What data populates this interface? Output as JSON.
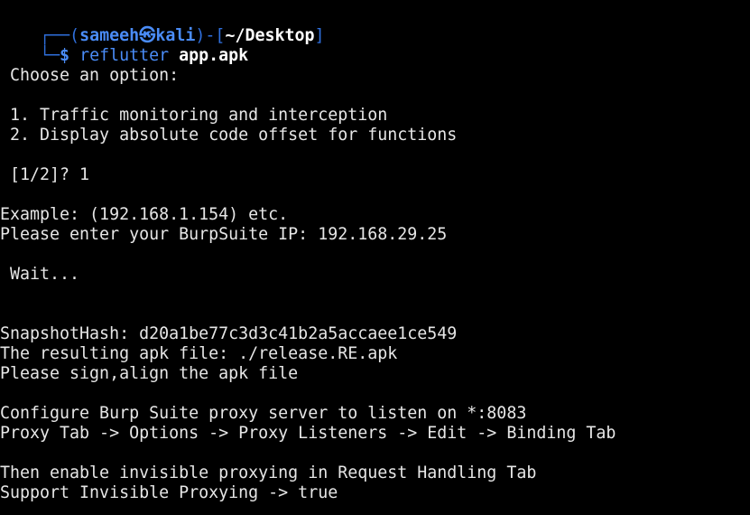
{
  "prompt": {
    "box_top": "┌──(",
    "user": "sameeh",
    "skull": "㉿",
    "host": "kali",
    "mid": ")-[",
    "cwd": "~/Desktop",
    "end": "]",
    "box_bottom": "└─",
    "dollar": "$ ",
    "command": "reflutter",
    "argument": "app.apk"
  },
  "output": {
    "choose": " Choose an option:",
    "option1": " 1. Traffic monitoring and interception",
    "option2": " 2. Display absolute code offset for functions",
    "answer": " [1/2]? 1",
    "example": "Example: (192.168.1.154) etc.",
    "enter_ip": "Please enter your BurpSuite IP: 192.168.29.25",
    "wait": " Wait...",
    "snapshot": "SnapshotHash: d20a1be77c3d3c41b2a5accaee1ce549",
    "result": "The resulting apk file: ./release.RE.apk",
    "sign": "Please sign,align the apk file",
    "configure": "Configure Burp Suite proxy server to listen on *:8083",
    "proxy_tab": "Proxy Tab -> Options -> Proxy Listeners -> Edit -> Binding Tab",
    "enable": "Then enable invisible proxying in Request Handling Tab",
    "support": "Support Invisible Proxying -> true"
  },
  "colors": {
    "background": "#000000",
    "text": "#e6e6e6",
    "prompt_blue": "#4a8cf7",
    "box_blue": "#2f6fdc",
    "bold_white": "#ffffff"
  }
}
